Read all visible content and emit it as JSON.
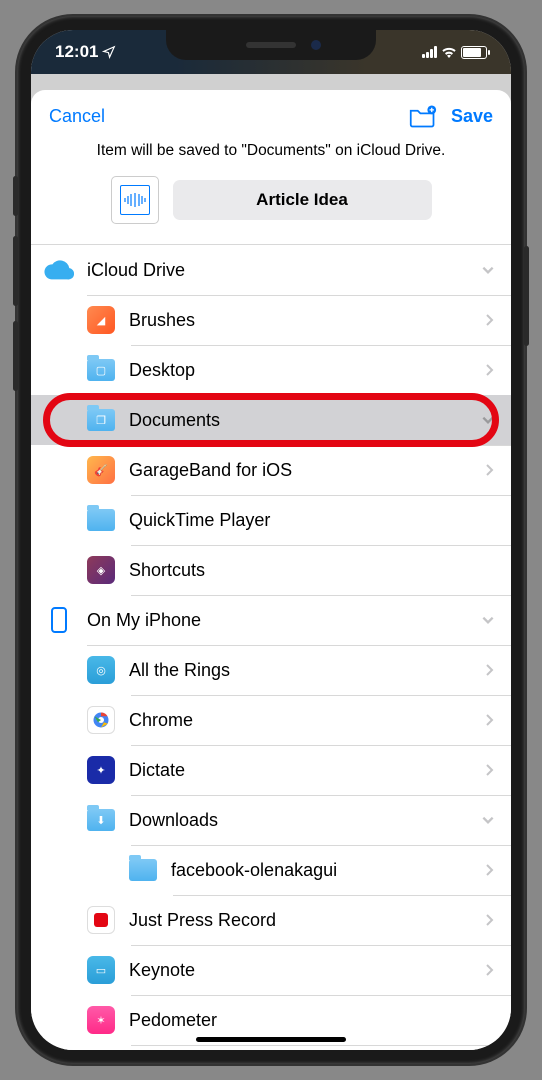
{
  "status": {
    "time": "12:01"
  },
  "header": {
    "cancel": "Cancel",
    "save": "Save"
  },
  "info_text": "Item will be saved to \"Documents\" on iCloud Drive.",
  "item": {
    "name": "Article Idea"
  },
  "sections": [
    {
      "label": "iCloud Drive",
      "icon": "cloud",
      "chevron": "down"
    },
    {
      "label": "On My iPhone",
      "icon": "phone",
      "chevron": "down"
    }
  ],
  "rows": {
    "brushes": "Brushes",
    "desktop": "Desktop",
    "documents": "Documents",
    "garageband": "GarageBand for iOS",
    "quicktime": "QuickTime Player",
    "shortcuts": "Shortcuts",
    "rings": "All the Rings",
    "chrome": "Chrome",
    "dictate": "Dictate",
    "downloads": "Downloads",
    "facebook": "facebook-olenakagui",
    "record": "Just Press Record",
    "keynote": "Keynote",
    "pedometer": "Pedometer"
  }
}
